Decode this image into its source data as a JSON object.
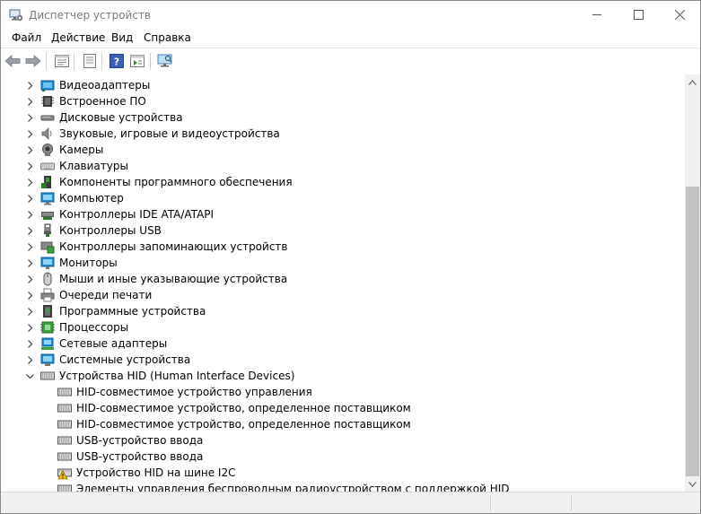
{
  "window": {
    "title": "Диспетчер устройств"
  },
  "menu": {
    "file": "Файл",
    "action": "Действие",
    "view": "Вид",
    "help": "Справка"
  },
  "toolbar": {
    "icons": [
      "back-arrow-icon",
      "forward-arrow-icon",
      "properties-icon",
      "update-driver-icon",
      "help-icon",
      "view-icon",
      "scan-hardware-icon"
    ]
  },
  "tree": {
    "categories": [
      {
        "label": "Видеоадаптеры",
        "icon": "display-adapter-icon",
        "expanded": false
      },
      {
        "label": "Встроенное ПО",
        "icon": "firmware-icon",
        "expanded": false
      },
      {
        "label": "Дисковые устройства",
        "icon": "disk-drive-icon",
        "expanded": false
      },
      {
        "label": "Звуковые, игровые и видеоустройства",
        "icon": "speaker-icon",
        "expanded": false
      },
      {
        "label": "Камеры",
        "icon": "camera-icon",
        "expanded": false
      },
      {
        "label": "Клавиатуры",
        "icon": "keyboard-icon",
        "expanded": false
      },
      {
        "label": "Компоненты программного обеспечения",
        "icon": "software-component-icon",
        "expanded": false
      },
      {
        "label": "Компьютер",
        "icon": "computer-icon",
        "expanded": false
      },
      {
        "label": "Контроллеры IDE ATA/ATAPI",
        "icon": "ide-controller-icon",
        "expanded": false
      },
      {
        "label": "Контроллеры USB",
        "icon": "usb-controller-icon",
        "expanded": false
      },
      {
        "label": "Контроллеры запоминающих устройств",
        "icon": "storage-controller-icon",
        "expanded": false
      },
      {
        "label": "Мониторы",
        "icon": "monitor-icon",
        "expanded": false
      },
      {
        "label": "Мыши и иные указывающие устройства",
        "icon": "mouse-icon",
        "expanded": false
      },
      {
        "label": "Очереди печати",
        "icon": "printer-icon",
        "expanded": false
      },
      {
        "label": "Программные устройства",
        "icon": "software-device-icon",
        "expanded": false
      },
      {
        "label": "Процессоры",
        "icon": "processor-icon",
        "expanded": false
      },
      {
        "label": "Сетевые адаптеры",
        "icon": "network-adapter-icon",
        "expanded": false
      },
      {
        "label": "Системные устройства",
        "icon": "system-device-icon",
        "expanded": false
      },
      {
        "label": "Устройства HID (Human Interface Devices)",
        "icon": "hid-icon",
        "expanded": true
      }
    ],
    "hid_children": [
      {
        "label": "HID-совместимое устройство управления",
        "icon": "hid-device-icon",
        "warning": false
      },
      {
        "label": "HID-совместимое устройство, определенное поставщиком",
        "icon": "hid-device-icon",
        "warning": false
      },
      {
        "label": "HID-совместимое устройство, определенное поставщиком",
        "icon": "hid-device-icon",
        "warning": false
      },
      {
        "label": "USB-устройство ввода",
        "icon": "hid-device-icon",
        "warning": false
      },
      {
        "label": "USB-устройство ввода",
        "icon": "hid-device-icon",
        "warning": false
      },
      {
        "label": "Устройство HID на шине I2C",
        "icon": "hid-warning-icon",
        "warning": true
      },
      {
        "label": "Элементы управления беспроводным радиоустройством с поддержкой HID",
        "icon": "hid-device-icon",
        "warning": false
      }
    ]
  },
  "scrollbar": {
    "position": 0.25,
    "visible_fraction": 0.75
  },
  "colors": {
    "accent": "#1f6fd6",
    "warning": "#f5c400"
  }
}
